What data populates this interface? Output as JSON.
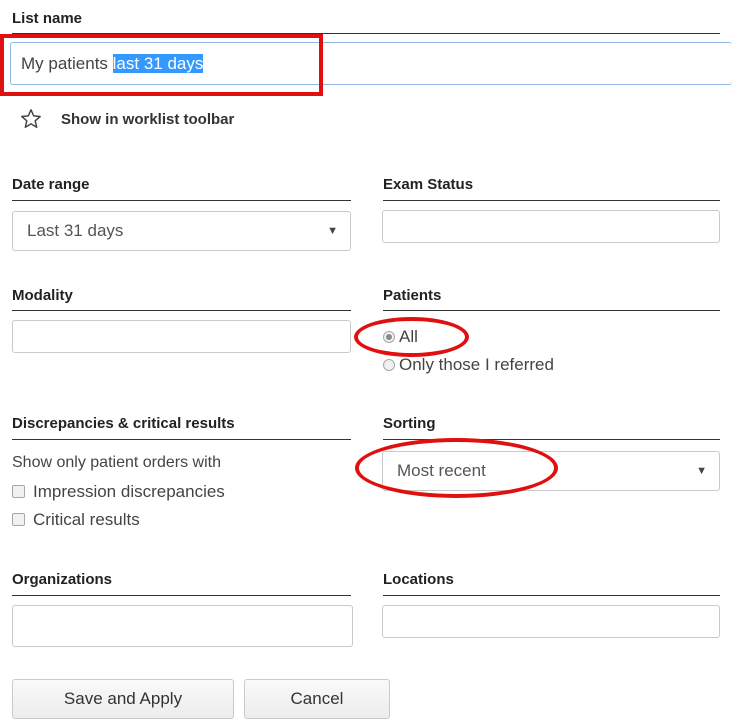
{
  "list_name": {
    "label": "List name",
    "value_plain": "My patients ",
    "value_selected": "last 31 days"
  },
  "worklist_toolbar": {
    "label": "Show in worklist toolbar",
    "icon": "star-outline-icon"
  },
  "date_range": {
    "label": "Date range",
    "selected": "Last 31 days"
  },
  "exam_status": {
    "label": "Exam Status",
    "value": ""
  },
  "modality": {
    "label": "Modality",
    "value": ""
  },
  "patients": {
    "label": "Patients",
    "options": [
      {
        "label": "All",
        "checked": true
      },
      {
        "label": "Only those I referred",
        "checked": false
      }
    ]
  },
  "discrepancies": {
    "label": "Discrepancies & critical results",
    "intro": "Show only patient orders with",
    "options": [
      {
        "label": "Impression discrepancies",
        "checked": false
      },
      {
        "label": "Critical results",
        "checked": false
      }
    ]
  },
  "sorting": {
    "label": "Sorting",
    "selected": "Most recent"
  },
  "organizations": {
    "label": "Organizations",
    "value": ""
  },
  "locations": {
    "label": "Locations",
    "value": ""
  },
  "buttons": {
    "save": "Save and Apply",
    "cancel": "Cancel"
  },
  "colors": {
    "annotation": "#e01010",
    "selection": "#3399ff"
  }
}
